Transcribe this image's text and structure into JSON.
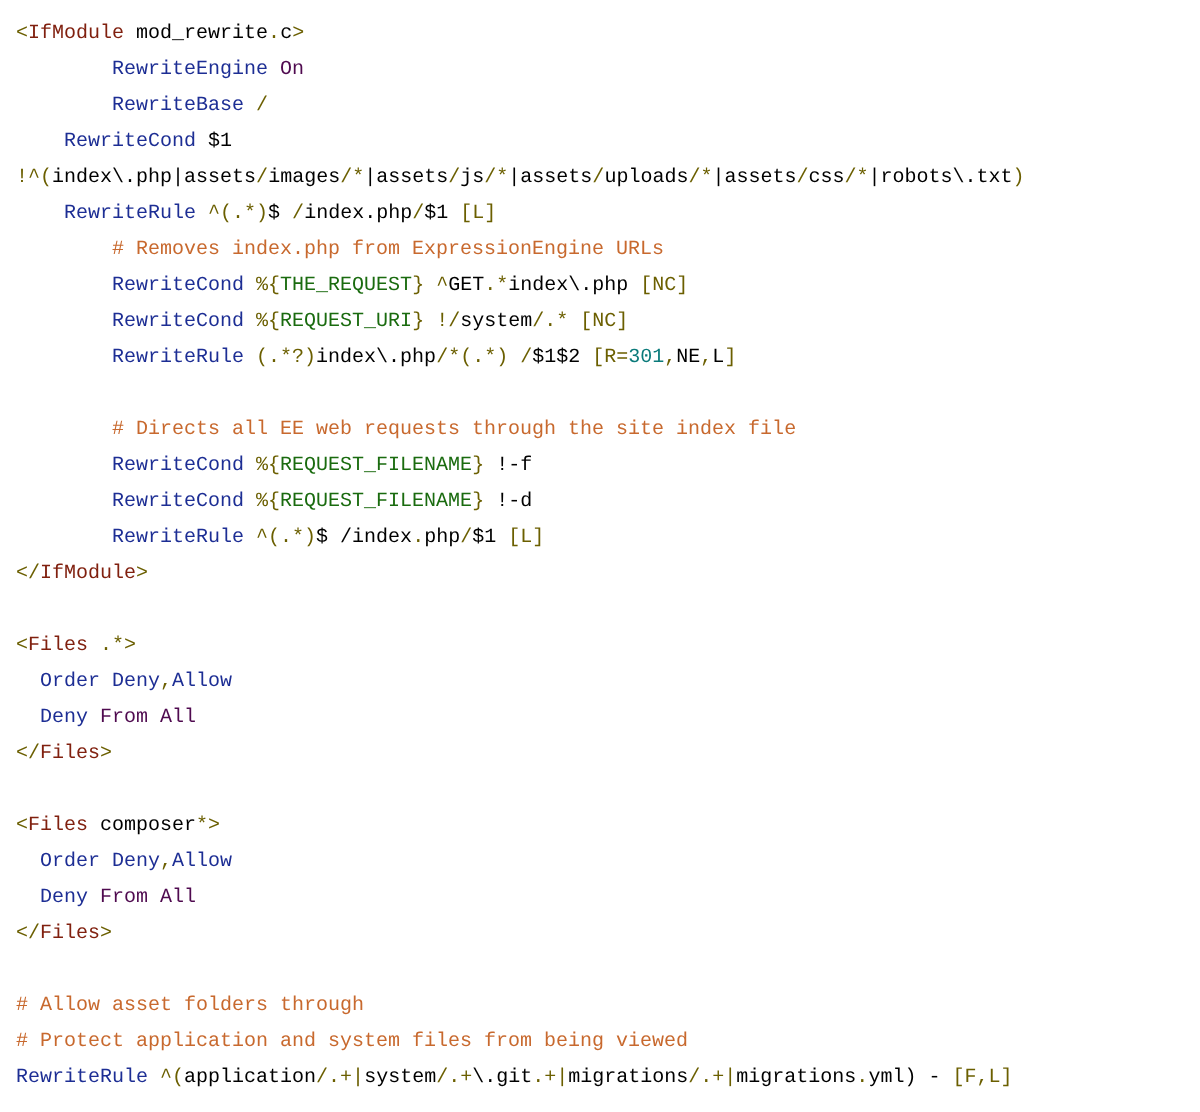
{
  "code_lines": [
    {
      "kind": "code",
      "tokens": [
        {
          "kind": "p",
          "text": "<"
        },
        {
          "kind": "t",
          "text": "IfModule"
        },
        {
          "kind": "x",
          "text": " mod_rewrite"
        },
        {
          "kind": "p",
          "text": "."
        },
        {
          "kind": "x",
          "text": "c"
        },
        {
          "kind": "p",
          "text": ">"
        }
      ]
    },
    {
      "kind": "code",
      "tokens": [
        {
          "kind": "d",
          "text": "        RewriteEngine"
        },
        {
          "kind": "k",
          "text": " On"
        }
      ]
    },
    {
      "kind": "code",
      "tokens": [
        {
          "kind": "d",
          "text": "        RewriteBase"
        },
        {
          "kind": "p",
          "text": " /"
        }
      ]
    },
    {
      "kind": "code",
      "tokens": [
        {
          "kind": "d",
          "text": "    RewriteCond"
        },
        {
          "kind": "x",
          "text": " $1"
        }
      ]
    },
    {
      "kind": "code",
      "tokens": [
        {
          "kind": "p",
          "text": "!^("
        },
        {
          "kind": "x",
          "text": "index\\.php|assets"
        },
        {
          "kind": "p",
          "text": "/"
        },
        {
          "kind": "x",
          "text": "images"
        },
        {
          "kind": "p",
          "text": "/*"
        },
        {
          "kind": "x",
          "text": "|assets"
        },
        {
          "kind": "p",
          "text": "/"
        },
        {
          "kind": "x",
          "text": "js"
        },
        {
          "kind": "p",
          "text": "/*"
        },
        {
          "kind": "x",
          "text": "|assets"
        },
        {
          "kind": "p",
          "text": "/"
        },
        {
          "kind": "x",
          "text": "uploads"
        },
        {
          "kind": "p",
          "text": "/*"
        },
        {
          "kind": "x",
          "text": "|assets"
        },
        {
          "kind": "p",
          "text": "/"
        },
        {
          "kind": "x",
          "text": "css"
        },
        {
          "kind": "p",
          "text": "/*"
        },
        {
          "kind": "x",
          "text": "|robots\\.txt"
        },
        {
          "kind": "p",
          "text": ")"
        }
      ]
    },
    {
      "kind": "code",
      "tokens": [
        {
          "kind": "d",
          "text": "    RewriteRule"
        },
        {
          "kind": "p",
          "text": " ^(.*)"
        },
        {
          "kind": "x",
          "text": "$ "
        },
        {
          "kind": "p",
          "text": "/"
        },
        {
          "kind": "x",
          "text": "index.php"
        },
        {
          "kind": "p",
          "text": "/"
        },
        {
          "kind": "x",
          "text": "$1 "
        },
        {
          "kind": "p",
          "text": "[L]"
        }
      ]
    },
    {
      "kind": "code",
      "tokens": [
        {
          "kind": "c",
          "text": "        # Removes index.php from ExpressionEngine URLs"
        }
      ]
    },
    {
      "kind": "code",
      "tokens": [
        {
          "kind": "d",
          "text": "        RewriteCond"
        },
        {
          "kind": "p",
          "text": " %{"
        },
        {
          "kind": "v",
          "text": "THE_REQUEST"
        },
        {
          "kind": "p",
          "text": "} ^"
        },
        {
          "kind": "x",
          "text": "GET"
        },
        {
          "kind": "p",
          "text": ".*"
        },
        {
          "kind": "x",
          "text": "index\\.php "
        },
        {
          "kind": "p",
          "text": "[NC]"
        }
      ]
    },
    {
      "kind": "code",
      "tokens": [
        {
          "kind": "d",
          "text": "        RewriteCond"
        },
        {
          "kind": "p",
          "text": " %{"
        },
        {
          "kind": "v",
          "text": "REQUEST_URI"
        },
        {
          "kind": "p",
          "text": "} !/"
        },
        {
          "kind": "x",
          "text": "system"
        },
        {
          "kind": "p",
          "text": "/.* [NC]"
        }
      ]
    },
    {
      "kind": "code",
      "tokens": [
        {
          "kind": "d",
          "text": "        RewriteRule"
        },
        {
          "kind": "p",
          "text": " (.*?)"
        },
        {
          "kind": "x",
          "text": "index\\.php"
        },
        {
          "kind": "p",
          "text": "/*(.*) /"
        },
        {
          "kind": "x",
          "text": "$1$2 "
        },
        {
          "kind": "p",
          "text": "[R="
        },
        {
          "kind": "n",
          "text": "301"
        },
        {
          "kind": "p",
          "text": ","
        },
        {
          "kind": "x",
          "text": "NE"
        },
        {
          "kind": "p",
          "text": ","
        },
        {
          "kind": "x",
          "text": "L"
        },
        {
          "kind": "p",
          "text": "]"
        }
      ]
    },
    {
      "kind": "blank"
    },
    {
      "kind": "code",
      "tokens": [
        {
          "kind": "c",
          "text": "        # Directs all EE web requests through the site index file"
        }
      ]
    },
    {
      "kind": "code",
      "tokens": [
        {
          "kind": "d",
          "text": "        RewriteCond"
        },
        {
          "kind": "p",
          "text": " %{"
        },
        {
          "kind": "v",
          "text": "REQUEST_FILENAME"
        },
        {
          "kind": "p",
          "text": "}"
        },
        {
          "kind": "x",
          "text": " !-f"
        }
      ]
    },
    {
      "kind": "code",
      "tokens": [
        {
          "kind": "d",
          "text": "        RewriteCond"
        },
        {
          "kind": "p",
          "text": " %{"
        },
        {
          "kind": "v",
          "text": "REQUEST_FILENAME"
        },
        {
          "kind": "p",
          "text": "}"
        },
        {
          "kind": "x",
          "text": " !-d"
        }
      ]
    },
    {
      "kind": "code",
      "tokens": [
        {
          "kind": "d",
          "text": "        RewriteRule"
        },
        {
          "kind": "p",
          "text": " ^(.*)"
        },
        {
          "kind": "x",
          "text": "$ /index"
        },
        {
          "kind": "p",
          "text": "."
        },
        {
          "kind": "x",
          "text": "php"
        },
        {
          "kind": "p",
          "text": "/"
        },
        {
          "kind": "x",
          "text": "$1 "
        },
        {
          "kind": "p",
          "text": "[L]"
        }
      ]
    },
    {
      "kind": "code",
      "tokens": [
        {
          "kind": "p",
          "text": "</"
        },
        {
          "kind": "t",
          "text": "IfModule"
        },
        {
          "kind": "p",
          "text": ">"
        }
      ]
    },
    {
      "kind": "blank"
    },
    {
      "kind": "code",
      "tokens": [
        {
          "kind": "p",
          "text": "<"
        },
        {
          "kind": "t",
          "text": "Files"
        },
        {
          "kind": "p",
          "text": " .*>"
        }
      ]
    },
    {
      "kind": "code",
      "tokens": [
        {
          "kind": "d",
          "text": "  Order Deny"
        },
        {
          "kind": "p",
          "text": ","
        },
        {
          "kind": "d",
          "text": "Allow"
        }
      ]
    },
    {
      "kind": "code",
      "tokens": [
        {
          "kind": "d",
          "text": "  Deny"
        },
        {
          "kind": "k",
          "text": " From All"
        }
      ]
    },
    {
      "kind": "code",
      "tokens": [
        {
          "kind": "p",
          "text": "</"
        },
        {
          "kind": "t",
          "text": "Files"
        },
        {
          "kind": "p",
          "text": ">"
        }
      ]
    },
    {
      "kind": "blank"
    },
    {
      "kind": "code",
      "tokens": [
        {
          "kind": "p",
          "text": "<"
        },
        {
          "kind": "t",
          "text": "Files"
        },
        {
          "kind": "x",
          "text": " composer"
        },
        {
          "kind": "p",
          "text": "*>"
        }
      ]
    },
    {
      "kind": "code",
      "tokens": [
        {
          "kind": "d",
          "text": "  Order Deny"
        },
        {
          "kind": "p",
          "text": ","
        },
        {
          "kind": "d",
          "text": "Allow"
        }
      ]
    },
    {
      "kind": "code",
      "tokens": [
        {
          "kind": "d",
          "text": "  Deny"
        },
        {
          "kind": "k",
          "text": " From All"
        }
      ]
    },
    {
      "kind": "code",
      "tokens": [
        {
          "kind": "p",
          "text": "</"
        },
        {
          "kind": "t",
          "text": "Files"
        },
        {
          "kind": "p",
          "text": ">"
        }
      ]
    },
    {
      "kind": "blank"
    },
    {
      "kind": "code",
      "tokens": [
        {
          "kind": "c",
          "text": "# Allow asset folders through"
        }
      ]
    },
    {
      "kind": "code",
      "tokens": [
        {
          "kind": "c",
          "text": "# Protect application and system files from being viewed"
        }
      ]
    },
    {
      "kind": "code",
      "tokens": [
        {
          "kind": "d",
          "text": "RewriteRule"
        },
        {
          "kind": "p",
          "text": " ^("
        },
        {
          "kind": "x",
          "text": "application"
        },
        {
          "kind": "p",
          "text": "/.+|"
        },
        {
          "kind": "x",
          "text": "system"
        },
        {
          "kind": "p",
          "text": "/.+"
        },
        {
          "kind": "x",
          "text": "\\.git"
        },
        {
          "kind": "p",
          "text": ".+|"
        },
        {
          "kind": "x",
          "text": "migrations"
        },
        {
          "kind": "p",
          "text": "/.+|"
        },
        {
          "kind": "x",
          "text": "migrations"
        },
        {
          "kind": "p",
          "text": "."
        },
        {
          "kind": "x",
          "text": "yml) - "
        },
        {
          "kind": "p",
          "text": "[F,L]"
        }
      ]
    }
  ]
}
